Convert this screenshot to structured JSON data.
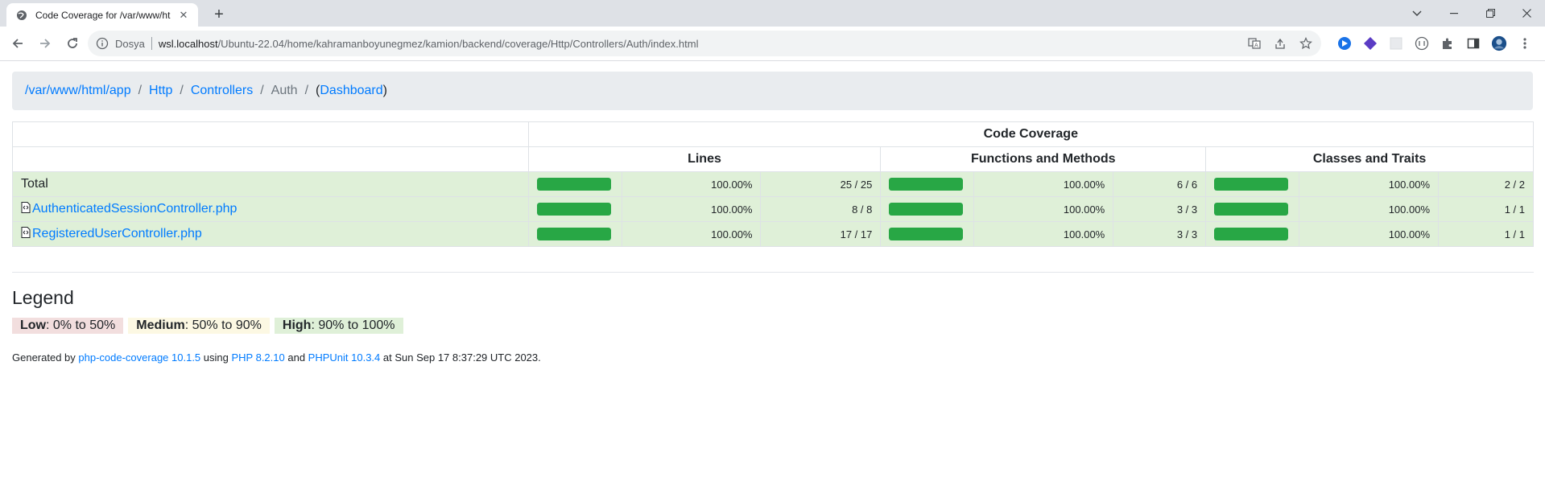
{
  "browser": {
    "tab_title": "Code Coverage for /var/www/ht",
    "tab_close": "✕",
    "new_tab": "+",
    "omnibox_label": "Dosya",
    "url_host": "wsl.localhost",
    "url_path": "/Ubuntu-22.04/home/kahramanboyunegmez/kamion/backend/coverage/Http/Controllers/Auth/index.html"
  },
  "breadcrumb": {
    "items": [
      "/var/www/html/app",
      "Http",
      "Controllers",
      "Auth"
    ],
    "dashboard_prefix": "(",
    "dashboard": "Dashboard",
    "dashboard_suffix": ")",
    "divider": "/"
  },
  "table": {
    "group_header": "Code Coverage",
    "col_lines": "Lines",
    "col_functions": "Functions and Methods",
    "col_classes": "Classes and Traits",
    "rows": [
      {
        "name": "Total",
        "lines_pct": "100.00%",
        "lines_count": "25 / 25",
        "lines_fill": 1.0,
        "funcs_pct": "100.00%",
        "funcs_count": "6 / 6",
        "funcs_fill": 1.0,
        "classes_pct": "100.00%",
        "classes_count": "2 / 2",
        "classes_fill": 1.0
      },
      {
        "name": "AuthenticatedSessionController.php",
        "lines_pct": "100.00%",
        "lines_count": "8 / 8",
        "lines_fill": 1.0,
        "funcs_pct": "100.00%",
        "funcs_count": "3 / 3",
        "funcs_fill": 1.0,
        "classes_pct": "100.00%",
        "classes_count": "1 / 1",
        "classes_fill": 1.0
      },
      {
        "name": "RegisteredUserController.php",
        "lines_pct": "100.00%",
        "lines_count": "17 / 17",
        "lines_fill": 1.0,
        "funcs_pct": "100.00%",
        "funcs_count": "3 / 3",
        "funcs_fill": 1.0,
        "classes_pct": "100.00%",
        "classes_count": "1 / 1",
        "classes_fill": 1.0
      }
    ]
  },
  "legend": {
    "title": "Legend",
    "low_label": "Low",
    "low_range": ": 0% to 50%",
    "medium_label": "Medium",
    "medium_range": ": 50% to 90%",
    "high_label": "High",
    "high_range": ": 90% to 100%"
  },
  "footer": {
    "generated_by": "Generated by ",
    "tool": "php-code-coverage 10.1.5",
    "using": " using ",
    "php": "PHP 8.2.10",
    "and": " and ",
    "phpunit": "PHPUnit 10.3.4",
    "timestamp": " at Sun Sep 17 8:37:29 UTC 2023."
  },
  "colors": {
    "bar_fill": "#28a745",
    "row_high": "#dff0d8",
    "link": "#007bff"
  }
}
